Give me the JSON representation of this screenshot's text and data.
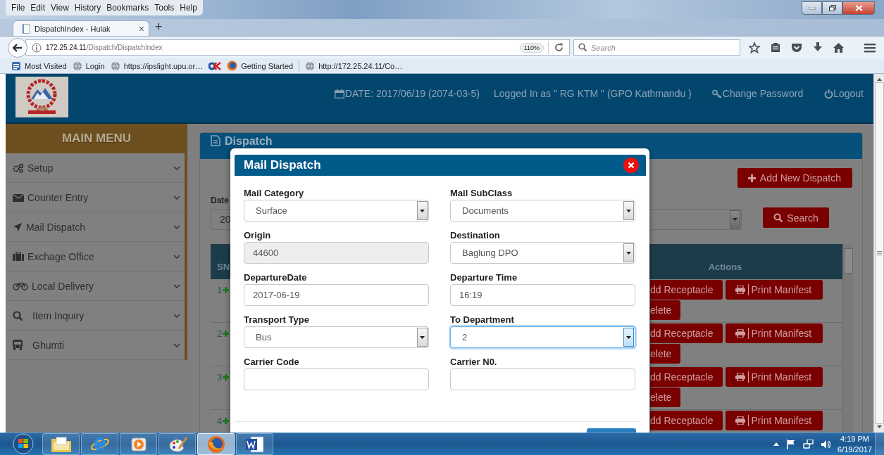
{
  "browser": {
    "menu": [
      "File",
      "Edit",
      "View",
      "History",
      "Bookmarks",
      "Tools",
      "Help"
    ],
    "tab": {
      "title": "DispatchIndex - Hulak",
      "close": "×"
    },
    "new_tab": "+",
    "address": {
      "url": "172.25.24.11/Dispatch/DispatchIndex",
      "zoom": "110%"
    },
    "search": {
      "placeholder": "Search"
    },
    "bookmarks": [
      "Most Visited",
      "Login",
      "https://ipslight.upu.or…",
      "Getting Started",
      "http://172.25.24.11/Co…"
    ]
  },
  "header": {
    "date": "DATE: 2017/06/19 (2074-03-5)",
    "user": "Logged In as \" RG KTM \" (GPO Kathmandu )",
    "change_password": "Change Password",
    "logout": "Logout"
  },
  "sidebar": {
    "title": "MAIN MENU",
    "items": [
      "Setup",
      "Counter Entry",
      "Mail Dispatch",
      "Exchage Office",
      "Local Delivery",
      "Item Inquiry",
      "Ghumti"
    ]
  },
  "panel": {
    "title": "Dispatch",
    "add_button": "Add New Dispatch",
    "date_label": "Date",
    "date_value": "20",
    "search_button": "Search",
    "table": {
      "columns": [
        "SN",
        "Actions"
      ],
      "rows": [
        {
          "sn": "1",
          "actions": [
            "dd Receptacle",
            "Print Manifest",
            "elete"
          ]
        },
        {
          "sn": "2",
          "actions": [
            "dd Receptacle",
            "Print Manifest",
            "elete"
          ]
        },
        {
          "sn": "3",
          "actions": [
            "dd Receptacle",
            "Print Manifest",
            "elete"
          ]
        },
        {
          "sn": "4",
          "actions": [
            "dd Receptacle",
            "Print Manifest"
          ]
        }
      ]
    }
  },
  "modal": {
    "title": "Mail Dispatch",
    "fields": [
      {
        "label": "Mail Category",
        "kind": "select",
        "value": "Surface",
        "disabled": false,
        "focused": false
      },
      {
        "label": "Mail SubClass",
        "kind": "select",
        "value": "Documents",
        "disabled": false,
        "focused": false
      },
      {
        "label": "Origin",
        "kind": "input",
        "value": "44600",
        "disabled": true,
        "focused": false
      },
      {
        "label": "Destination",
        "kind": "select",
        "value": "Baglung DPO",
        "disabled": false,
        "focused": false
      },
      {
        "label": "DepartureDate",
        "kind": "input",
        "value": "2017-06-19",
        "disabled": false,
        "focused": false
      },
      {
        "label": "Departure Time",
        "kind": "input",
        "value": "16:19",
        "disabled": false,
        "focused": false
      },
      {
        "label": "Transport Type",
        "kind": "select",
        "value": "Bus",
        "disabled": false,
        "focused": false
      },
      {
        "label": "To Department",
        "kind": "select",
        "value": "2",
        "disabled": false,
        "focused": true
      },
      {
        "label": "Carrier Code",
        "kind": "input",
        "disabled": false,
        "focused": false
      },
      {
        "label": "Carrier N0.",
        "kind": "input",
        "disabled": false,
        "focused": false
      }
    ]
  },
  "taskbar": {
    "apps": [
      {
        "selected": false
      },
      {
        "selected": false
      },
      {
        "selected": false
      },
      {
        "selected": false
      },
      {
        "selected": true
      },
      {
        "selected": false
      }
    ],
    "time": "4:19 PM",
    "date": "6/19/2017"
  }
}
